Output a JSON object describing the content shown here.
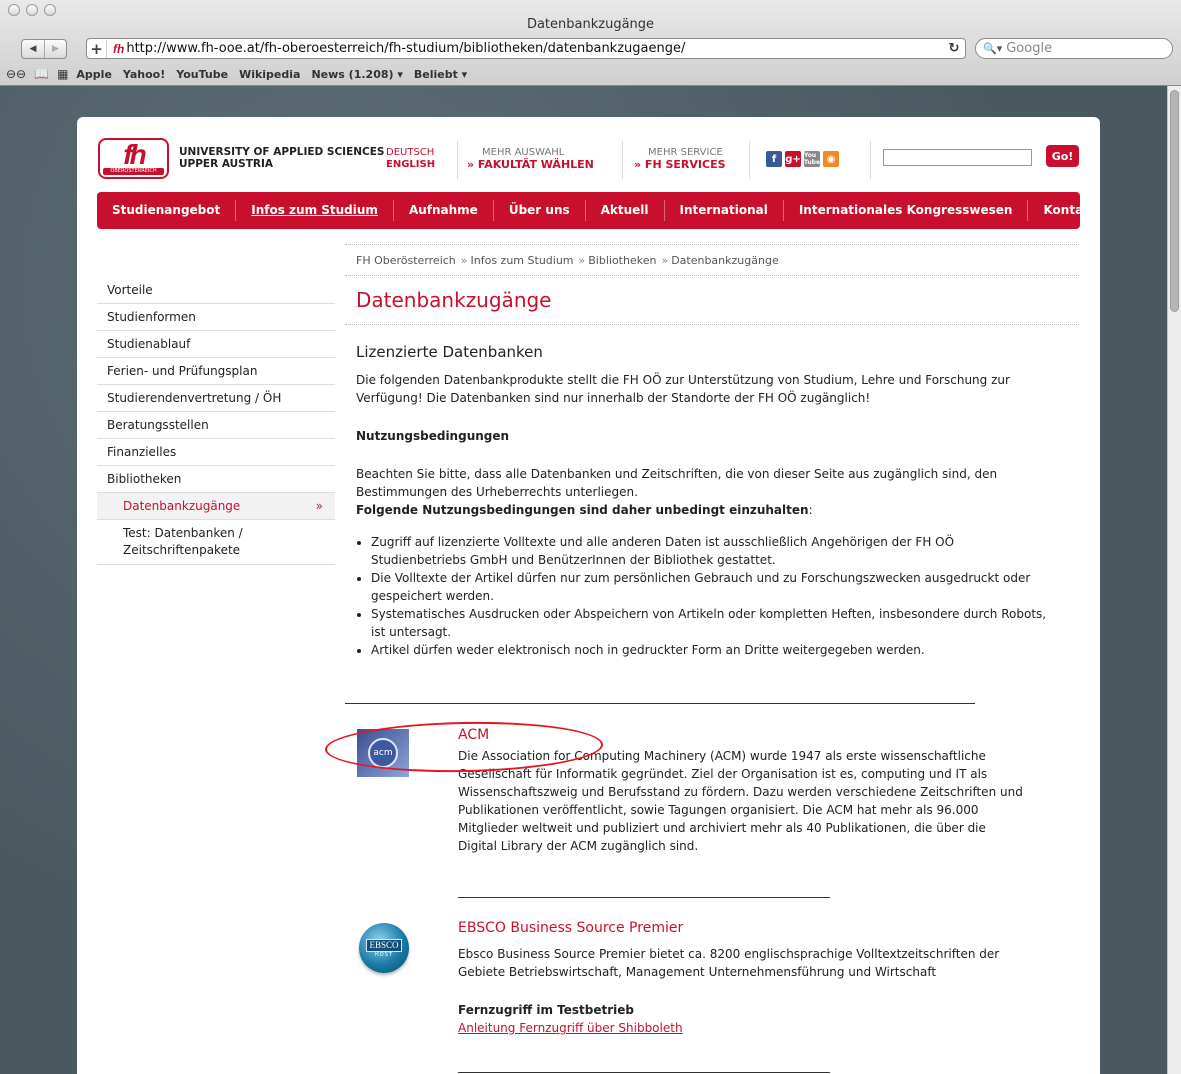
{
  "browser": {
    "window_title": "Datenbankzugänge",
    "url": "http://www.fh-ooe.at/fh-oberoesterreich/fh-studium/bibliotheken/datenbankzugaenge/",
    "search_placeholder": "Google",
    "bookmarks": [
      "Apple",
      "Yahoo!",
      "YouTube",
      "Wikipedia",
      "News (1.208) ▾",
      "Beliebt ▾"
    ]
  },
  "header": {
    "logo_text": "fh",
    "logo_sub": "OBERÖSTERREICH",
    "university_line1": "UNIVERSITY OF APPLIED SCIENCES",
    "university_line2": "UPPER AUSTRIA",
    "lang_de": "DEUTSCH",
    "lang_en": "ENGLISH",
    "menu1_small": "MEHR AUSWAHL",
    "menu1_big": "» FAKULTÄT WÄHLEN",
    "menu2_small": "MEHR SERVICE",
    "menu2_big": "» FH SERVICES",
    "go_label": "Go!"
  },
  "nav": [
    "Studienangebot",
    "Infos zum Studium",
    "Aufnahme",
    "Über uns",
    "Aktuell",
    "International",
    "Internationales Kongresswesen",
    "Kontakt"
  ],
  "breadcrumb": [
    "FH Oberösterreich",
    "Infos zum Studium",
    "Bibliotheken",
    "Datenbankzugänge"
  ],
  "sidebar": {
    "items": [
      "Vorteile",
      "Studienformen",
      "Studienablauf",
      "Ferien- und Prüfungsplan",
      "Studierendenvertretung / ÖH",
      "Beratungsstellen",
      "Finanzielles",
      "Bibliotheken"
    ],
    "sub_current": "Datenbankzugänge",
    "sub_other": "Test: Datenbanken / Zeitschriftenpakete"
  },
  "content": {
    "title": "Datenbankzugänge",
    "subtitle": "Lizenzierte Datenbanken",
    "intro": "Die folgenden Datenbankprodukte stellt die FH OÖ zur Unterstützung von Studium, Lehre und Forschung zur Verfügung! Die Datenbanken sind nur innerhalb der Standorte der FH OÖ zugänglich!",
    "terms_heading": "Nutzungsbedingungen",
    "terms_text": "Beachten Sie bitte, dass alle Datenbanken und Zeitschriften, die von dieser Seite aus zugänglich sind, den Bestimmungen des Urheberrechts unterliegen.",
    "terms_bold": "Folgende Nutzungsbedingungen sind daher unbedingt einzuhalten",
    "terms_colon": ":",
    "rules": [
      "Zugriff auf lizenzierte Volltexte und alle anderen Daten ist ausschließlich Angehörigen der FH OÖ Studienbetriebs GmbH und BenützerInnen der Bibliothek gestattet.",
      "Die Volltexte der Artikel dürfen nur zum persönlichen Gebrauch und zu Forschungszwecken ausgedruckt oder gespeichert werden.",
      "Systematisches Ausdrucken oder Abspeichern von Artikeln oder kompletten Heften, insbesondere durch Robots, ist untersagt.",
      "Artikel dürfen weder elektronisch noch in gedruckter Form an Dritte weitergegeben werden."
    ]
  },
  "databases": [
    {
      "name": "ACM",
      "logo_text": "acm",
      "description": "Die Association for Computing Machinery (ACM) wurde 1947 als erste wissenschaftliche Gesellschaft für Informatik gegründet. Ziel der Organisation ist es, computing und IT als Wissenschaftszweig und Berufsstand zu fördern. Dazu werden verschiedene Zeitschriften und Publikationen veröffentlicht, sowie Tagungen organisiert. Die ACM hat mehr als 96.000 Mitglieder weltweit und publiziert und archiviert mehr als 40 Publikationen, die über die Digital Library der ACM zugänglich sind."
    },
    {
      "name": "EBSCO Business Source Premier",
      "logo_text": "EBSCO",
      "logo_sub": "HOST",
      "description": "Ebsco Business Source Premier bietet ca. 8200 englischsprachige Volltextzeitschriften der Gebiete Betriebswirtschaft,  Management Unternehmensführung und Wirtschaft",
      "remote_heading": "Fernzugriff im Testbetrieb",
      "remote_link": "Anleitung Fernzugriff über Shibboleth"
    }
  ],
  "colors": {
    "brand_red": "#c8102e",
    "annotation_red": "#e8141f",
    "page_background": "#4f5e66"
  }
}
